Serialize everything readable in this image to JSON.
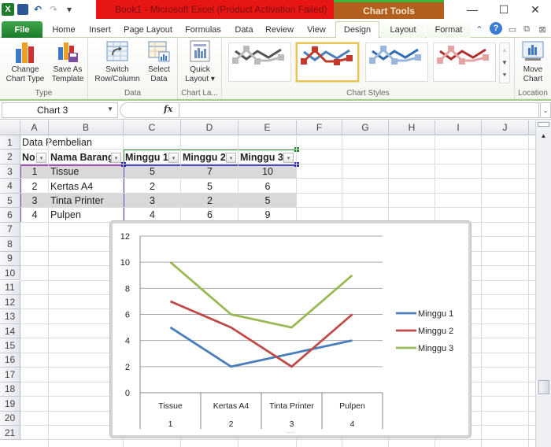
{
  "titlebar": {
    "title": "Book1  -  Microsoft Excel (Product Activation Failed)",
    "context_label": "Chart Tools",
    "minimize": "—",
    "maximize": "☐",
    "close": "✕",
    "qat": {
      "excel_icon": "X",
      "save_icon": "💾",
      "undo_icon": "↶",
      "redo_icon": "↷",
      "customize_icon": "▾"
    }
  },
  "tabs": [
    {
      "label": "File"
    },
    {
      "label": "Home"
    },
    {
      "label": "Insert"
    },
    {
      "label": "Page Layout"
    },
    {
      "label": "Formulas"
    },
    {
      "label": "Data"
    },
    {
      "label": "Review"
    },
    {
      "label": "View"
    },
    {
      "label": "Design"
    },
    {
      "label": "Layout"
    },
    {
      "label": "Format"
    }
  ],
  "tab_right_icons": {
    "minimize_ribbon": "⌃",
    "help": "?",
    "win_min": "▭",
    "win_restore": "⧉",
    "win_close": "⊠"
  },
  "ribbon": {
    "groups": [
      {
        "label": "Type",
        "buttons": [
          {
            "label": "Change\nChart Type"
          },
          {
            "label": "Save As\nTemplate"
          }
        ]
      },
      {
        "label": "Data",
        "buttons": [
          {
            "label": "Switch\nRow/Column"
          },
          {
            "label": "Select\nData"
          }
        ]
      },
      {
        "label": "Chart La...",
        "buttons": [
          {
            "label": "Quick\nLayout ▾"
          }
        ]
      },
      {
        "label": "Chart Styles",
        "styles": [
          "gray",
          "blue-red",
          "blue",
          "red"
        ],
        "selected_style": 1
      },
      {
        "label": "Location",
        "buttons": [
          {
            "label": "Move\nChart"
          }
        ]
      }
    ],
    "gallery_scroll": {
      "up": "▲",
      "down": "▼",
      "more": "⯆"
    }
  },
  "formula_bar": {
    "name_box": "Chart 3",
    "fx": "fx",
    "formula": ""
  },
  "sheet": {
    "columns": [
      "A",
      "B",
      "C",
      "D",
      "E",
      "F",
      "G",
      "H",
      "I",
      "J"
    ],
    "rows": [
      "1",
      "2",
      "3",
      "4",
      "5",
      "6",
      "7",
      "8",
      "9",
      "10",
      "11",
      "12",
      "13",
      "14",
      "15",
      "16",
      "17",
      "18",
      "19",
      "20",
      "21"
    ],
    "title_cell": "Data Pembelian",
    "table_headers": [
      "No",
      "Nama Barang",
      "Minggu 1",
      "Minggu 2",
      "Minggu 3"
    ],
    "table_rows": [
      [
        "1",
        "Tissue",
        "5",
        "7",
        "10"
      ],
      [
        "2",
        "Kertas A4",
        "2",
        "5",
        "6"
      ],
      [
        "3",
        "Tinta Printer",
        "3",
        "2",
        "5"
      ],
      [
        "4",
        "Pulpen",
        "4",
        "6",
        "9"
      ]
    ],
    "filter_glyph": "▾"
  },
  "colors": {
    "series1": "#4a7ebb",
    "series2": "#be4b48",
    "series3": "#98b954",
    "band": "#d9d9d9"
  },
  "chart_data": {
    "type": "line",
    "title": "",
    "xlabel": "",
    "ylabel": "",
    "categories": [
      "Tissue",
      "Kertas A4",
      "Tinta Printer",
      "Pulpen"
    ],
    "category_numbers": [
      "1",
      "2",
      "3",
      "4"
    ],
    "series": [
      {
        "name": "Minggu 1",
        "values": [
          5,
          2,
          3,
          4
        ]
      },
      {
        "name": "Minggu 2",
        "values": [
          7,
          5,
          2,
          6
        ]
      },
      {
        "name": "Minggu 3",
        "values": [
          10,
          6,
          5,
          9
        ]
      }
    ],
    "ylim": [
      0,
      12
    ],
    "yticks": [
      0,
      2,
      4,
      6,
      8,
      10,
      12
    ],
    "grid": true,
    "legend": "right"
  }
}
